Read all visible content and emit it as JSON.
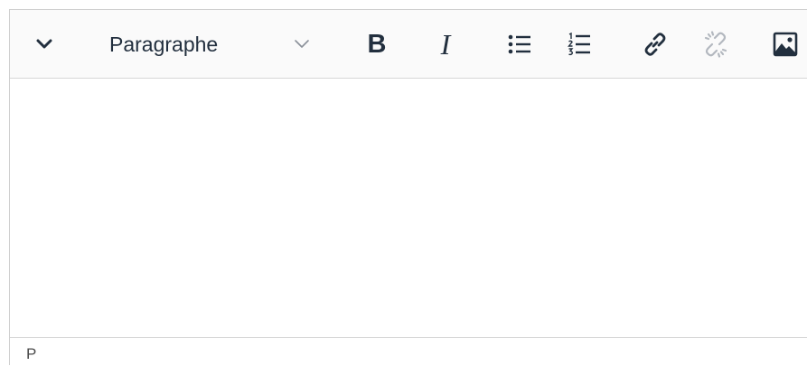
{
  "toolbar": {
    "more_icon": "chevron-down-icon",
    "format_select": {
      "selected_value": "Paragraphe",
      "icon": "chevron-down-icon"
    },
    "buttons": [
      {
        "icon": "bold-icon",
        "label": "B"
      },
      {
        "icon": "italic-icon",
        "label": "I"
      },
      {
        "icon": "bullet-list-icon"
      },
      {
        "icon": "numbered-list-icon"
      },
      {
        "icon": "link-icon"
      },
      {
        "icon": "unlink-icon"
      },
      {
        "icon": "image-icon"
      }
    ]
  },
  "content": {
    "text": ""
  },
  "statusbar": {
    "path": "P"
  },
  "colors": {
    "icon": "#222f3e",
    "disabled_icon": "#b3b8bf",
    "toolbar_bg": "#fafafa",
    "border": "#d6d6d6"
  }
}
